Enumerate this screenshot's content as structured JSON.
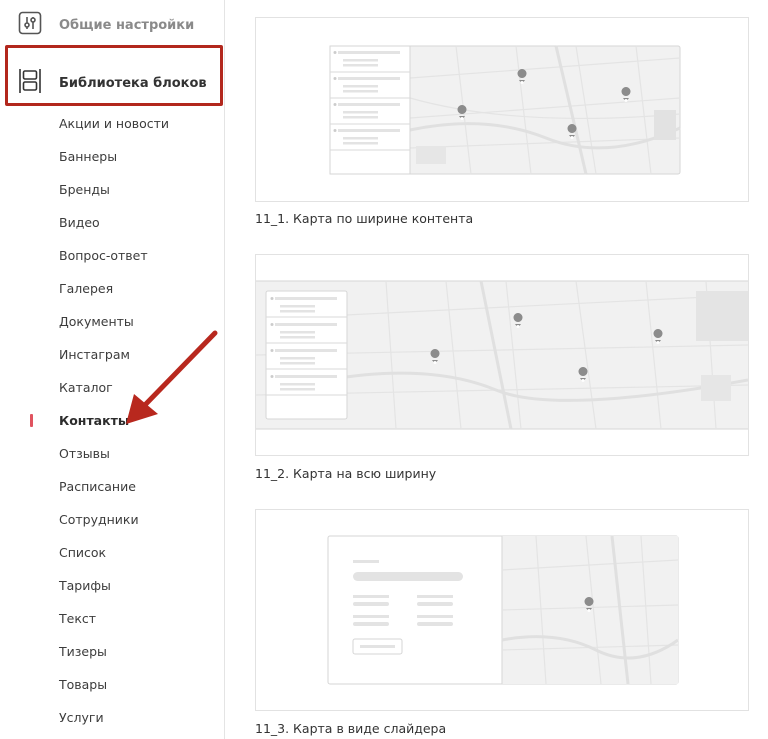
{
  "sidebar": {
    "top_item": {
      "label": "Общие настройки",
      "icon": "sliders-icon"
    },
    "library_item": {
      "label": "Библиотека блоков",
      "icon": "blocks-icon"
    },
    "items": [
      {
        "label": "Акции и новости"
      },
      {
        "label": "Баннеры"
      },
      {
        "label": "Бренды"
      },
      {
        "label": "Видео"
      },
      {
        "label": "Вопрос-ответ"
      },
      {
        "label": "Галерея"
      },
      {
        "label": "Документы"
      },
      {
        "label": "Инстаграм"
      },
      {
        "label": "Каталог"
      },
      {
        "label": "Контакты",
        "active": true
      },
      {
        "label": "Отзывы"
      },
      {
        "label": "Расписание"
      },
      {
        "label": "Сотрудники"
      },
      {
        "label": "Список"
      },
      {
        "label": "Тарифы"
      },
      {
        "label": "Текст"
      },
      {
        "label": "Тизеры"
      },
      {
        "label": "Товары"
      },
      {
        "label": "Услуги"
      }
    ]
  },
  "blocks": [
    {
      "caption": "11_1. Карта по ширине контента"
    },
    {
      "caption": "11_2. Карта на всю ширину"
    },
    {
      "caption": "11_3. Карта в виде слайдера"
    }
  ],
  "colors": {
    "highlight": "#b2271d",
    "arrow": "#b8281e",
    "active_marker": "#e0535f"
  }
}
